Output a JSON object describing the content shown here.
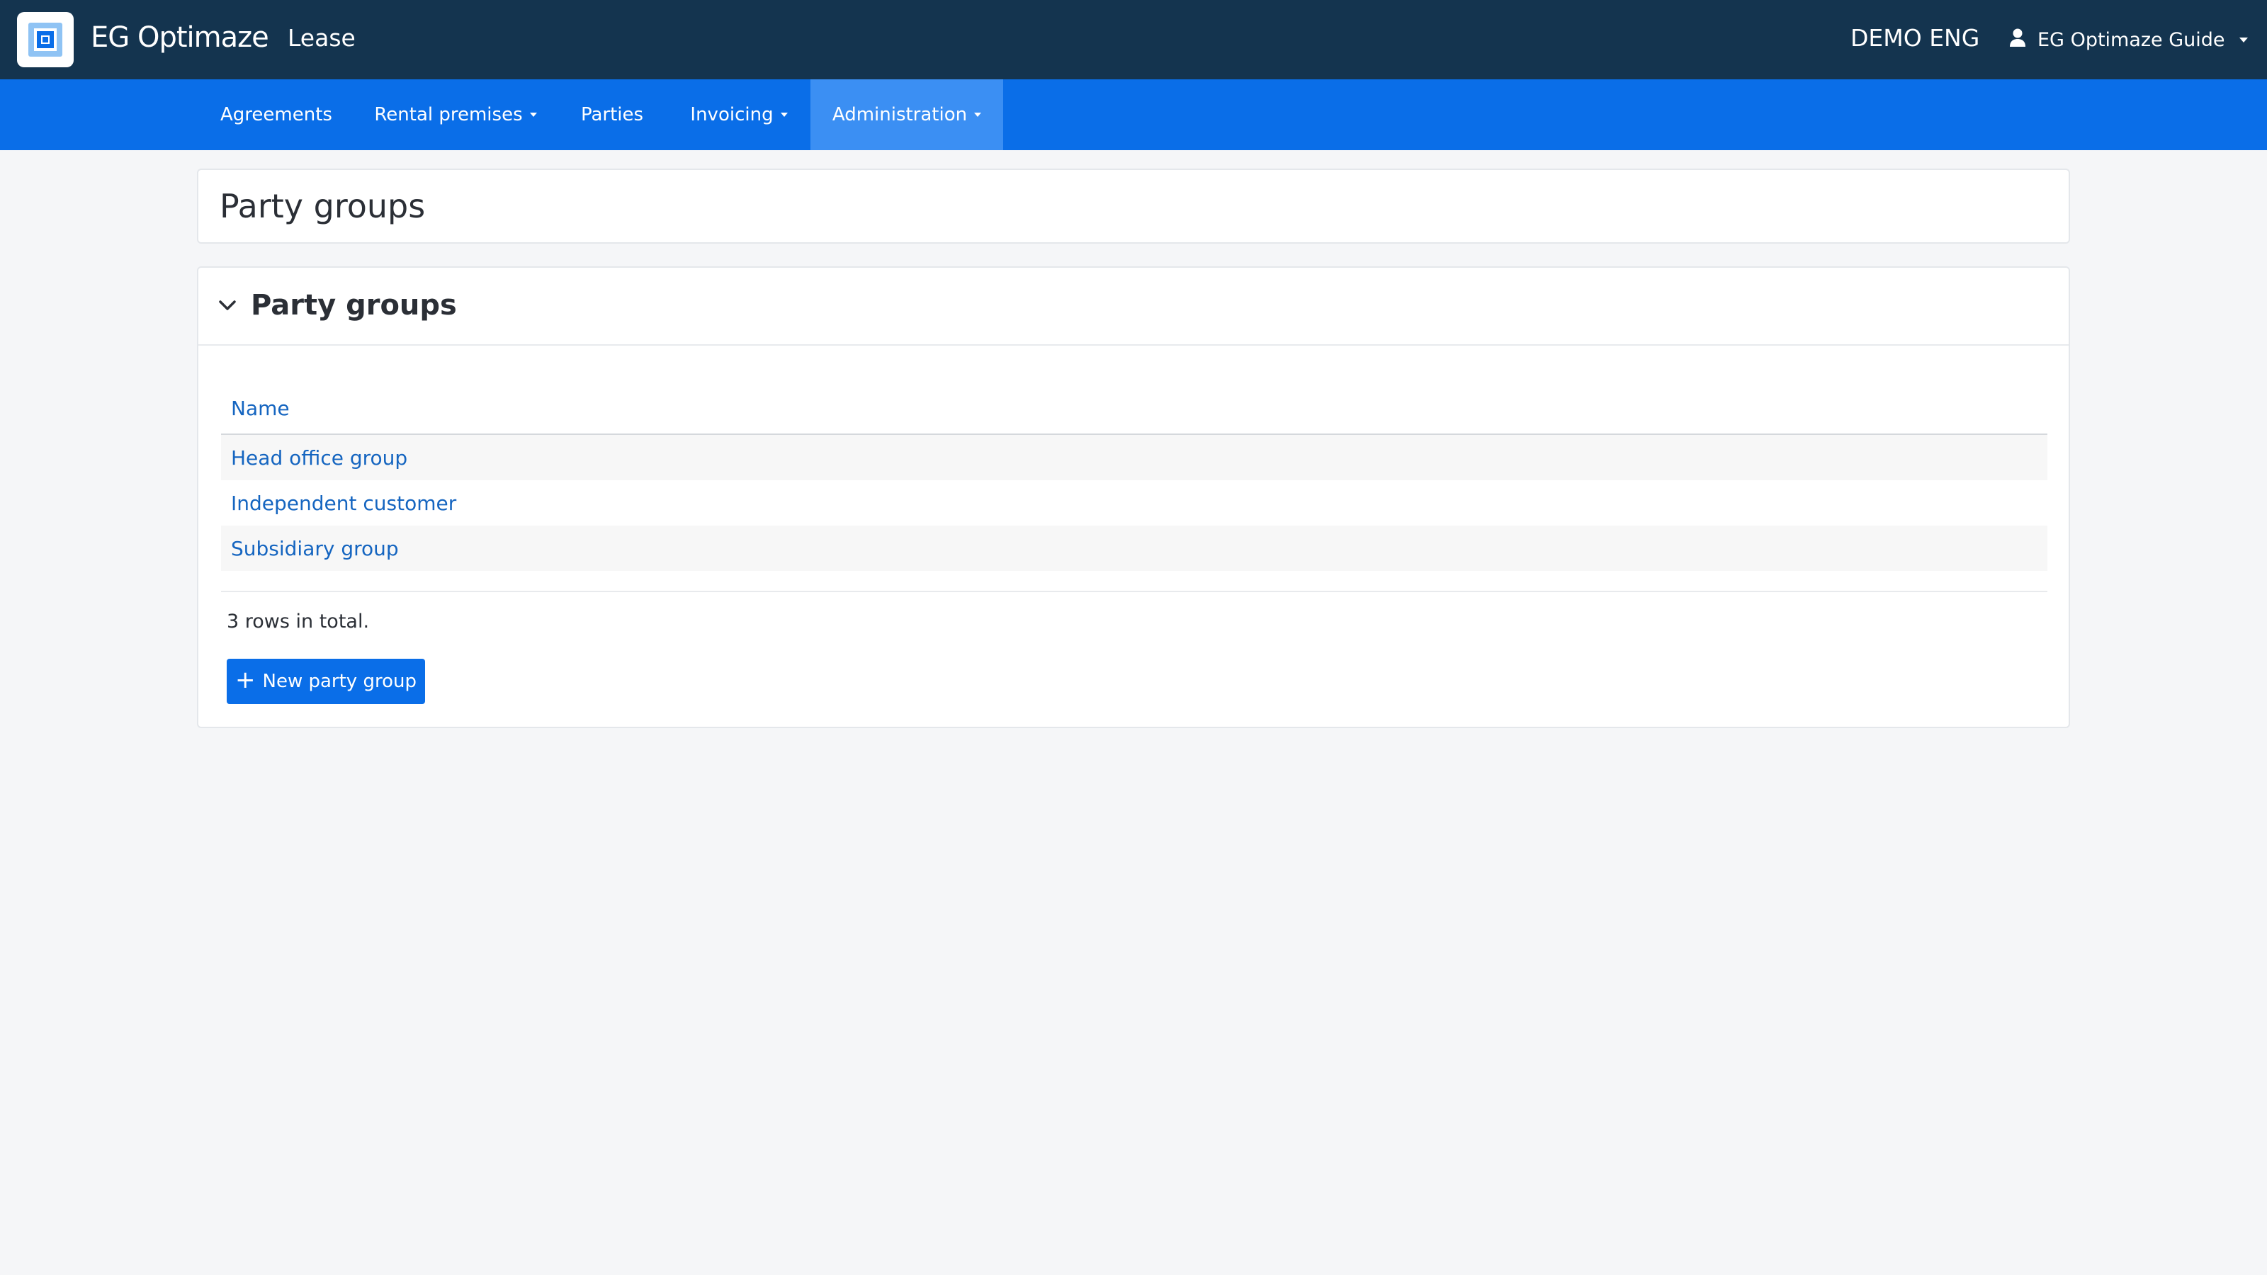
{
  "header": {
    "app_name": "EG Optimaze",
    "module": "Lease",
    "environment": "DEMO ENG",
    "user": "EG Optimaze Guide"
  },
  "nav": {
    "items": [
      {
        "label": "Agreements"
      },
      {
        "label": "Rental premises"
      },
      {
        "label": "Parties"
      },
      {
        "label": "Invoicing"
      },
      {
        "label": "Administration"
      }
    ],
    "active": "Administration"
  },
  "page": {
    "title": "Party groups"
  },
  "section": {
    "title": "Party groups",
    "table": {
      "columns": [
        "Name"
      ],
      "rows": [
        {
          "name": "Head office group"
        },
        {
          "name": "Independent customer"
        },
        {
          "name": "Subsidiary group"
        }
      ]
    },
    "rows_total": "3 rows in total.",
    "new_button_label": "New party group"
  },
  "icons": {
    "logo": "eg-logo-icon",
    "user": "user-icon",
    "chevron": "chevron-down-icon",
    "plus": "plus-icon"
  },
  "colors": {
    "header_bg": "#14344f",
    "nav_bg": "#0a6ee8",
    "nav_active_bg": "#3b8ff3",
    "link": "#1565c0",
    "button_bg": "#0a6ee8"
  }
}
